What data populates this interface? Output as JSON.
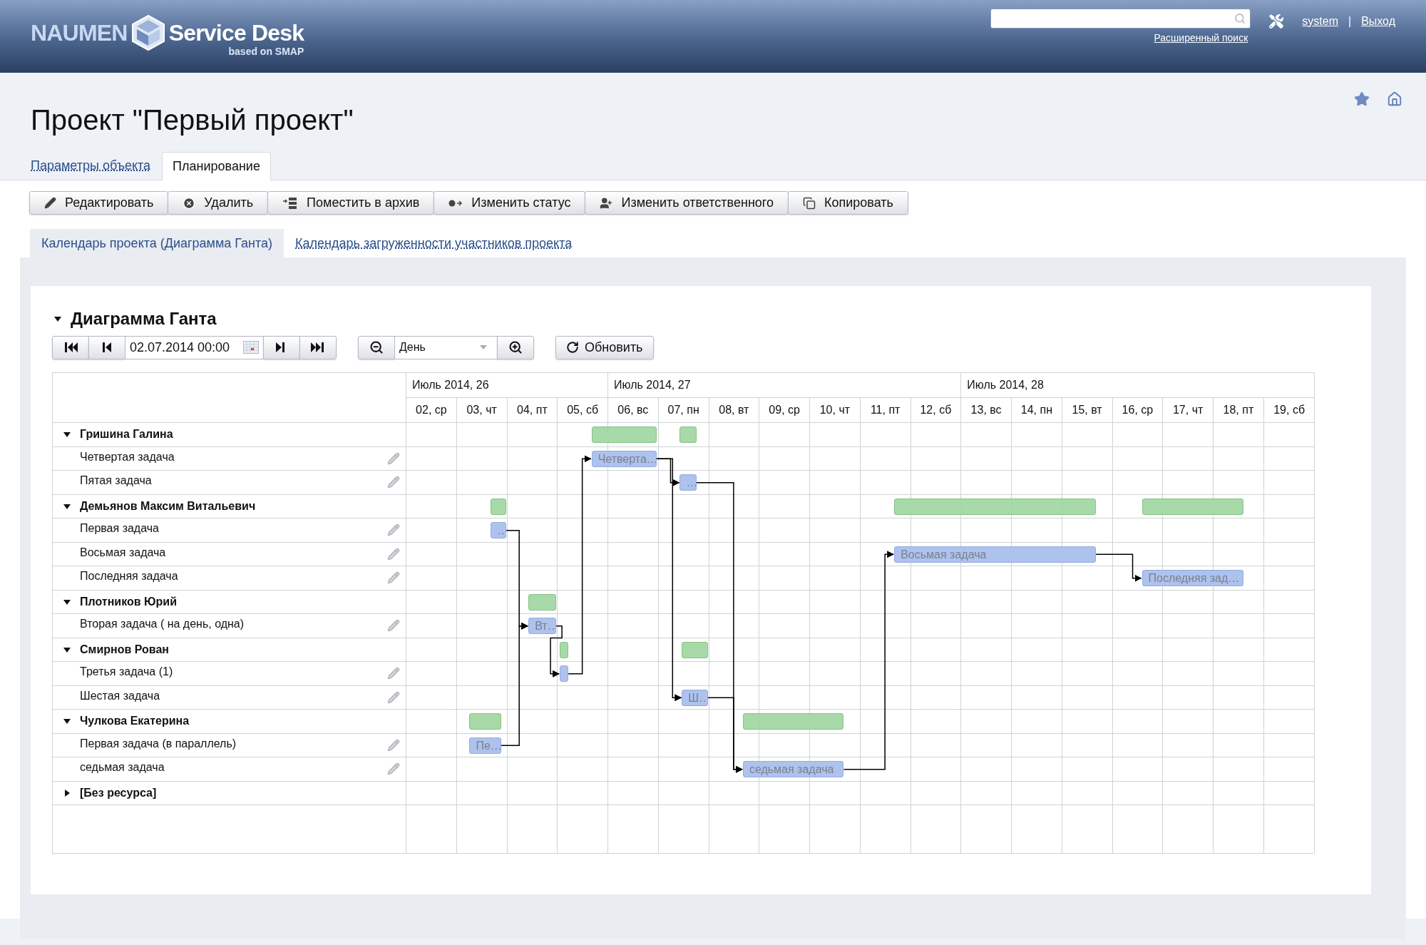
{
  "header": {
    "logo": {
      "brand": "NAUMEN",
      "product": "Service Desk",
      "subtitle": "based on SMAP"
    },
    "search": {
      "link": "Расширенный поиск"
    },
    "user": "system",
    "separator": "|",
    "logout": "Выход"
  },
  "title": "Проект \"Первый проект\"",
  "tabs": [
    {
      "label": "Параметры объекта",
      "selected": false
    },
    {
      "label": "Планирование",
      "selected": true
    }
  ],
  "actions": [
    {
      "label": "Редактировать",
      "kind": "edit"
    },
    {
      "label": "Удалить",
      "kind": "delete"
    },
    {
      "label": "Поместить в архив",
      "kind": "archive"
    },
    {
      "label": "Изменить статус",
      "kind": "status"
    },
    {
      "label": "Изменить ответственного",
      "kind": "assign"
    },
    {
      "label": "Копировать",
      "kind": "copy"
    }
  ],
  "subtabs": [
    {
      "label": "Календарь проекта (Диаграмма Ганта)",
      "selected": true
    },
    {
      "label": "Календарь загруженности участников проекта",
      "selected": false
    }
  ],
  "gantt": {
    "title": "Диаграмма Ганта",
    "expanded": true,
    "toolbar": {
      "date": "02.07.2014 00:00",
      "scale": "День",
      "refresh": "Обновить"
    },
    "weeks": [
      {
        "label": "Июль 2014, 26",
        "days": [
          "02, ср",
          "03, чт",
          "04, пт",
          "05, сб"
        ]
      },
      {
        "label": "Июль 2014, 27",
        "days": [
          "06, вс",
          "07, пн",
          "08, вт",
          "09, ср",
          "10, чт",
          "11, пт",
          "12, сб"
        ]
      },
      {
        "label": "Июль 2014, 28",
        "days": [
          "13, вс",
          "14, пн",
          "15, вт",
          "16, ср",
          "17, чт",
          "18, пт",
          "19, сб"
        ]
      }
    ],
    "groups": [
      {
        "name": "Гришина Галина",
        "expanded": true,
        "tasks": [
          {
            "name": "Четвертая задача",
            "bar_label": "Четверта…"
          },
          {
            "name": "Пятая задача",
            "bar_label": "…"
          }
        ]
      },
      {
        "name": "Демьянов Максим Витальевич",
        "expanded": true,
        "tasks": [
          {
            "name": "Первая задача",
            "bar_label": "…"
          },
          {
            "name": "Восьмая задача",
            "bar_label": "Восьмая задача"
          },
          {
            "name": "Последняя задача",
            "bar_label": "Последняя зад…"
          }
        ]
      },
      {
        "name": "Плотников Юрий",
        "expanded": true,
        "tasks": [
          {
            "name": "Вторая задача ( на день, одна)",
            "bar_label": "Вт…"
          }
        ]
      },
      {
        "name": "Смирнов Рован",
        "expanded": true,
        "tasks": [
          {
            "name": "Третья задача (1)"
          },
          {
            "name": "Шестая задача",
            "bar_label": "Ш…"
          }
        ]
      },
      {
        "name": "Чулкова Екатерина",
        "expanded": true,
        "tasks": [
          {
            "name": "Первая задача (в параллель)",
            "bar_label": "Пе…"
          },
          {
            "name": "седьмая задача",
            "bar_label": "седьмая задача"
          }
        ]
      },
      {
        "name": "[Без ресурса]",
        "expanded": false
      }
    ]
  }
}
